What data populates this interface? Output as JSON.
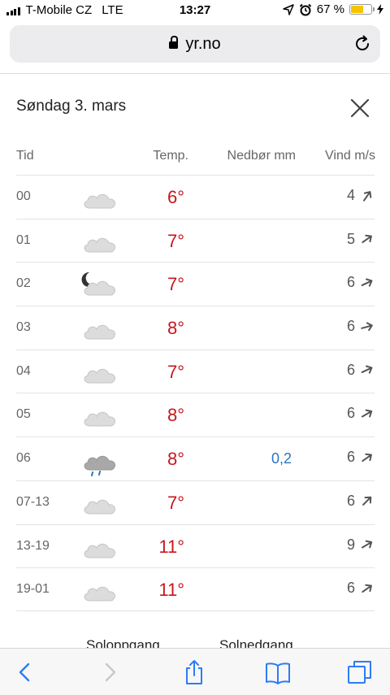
{
  "status_bar": {
    "carrier": "T-Mobile CZ",
    "network": "LTE",
    "time": "13:27",
    "battery": "67 %",
    "battery_level": 0.67,
    "battery_color": "#f5c400"
  },
  "browser": {
    "url": "yr.no"
  },
  "forecast": {
    "day_title": "Søndag 3. mars",
    "columns": {
      "time": "Tid",
      "temp": "Temp.",
      "precip": "Nedbør mm",
      "wind": "Vind m/s"
    },
    "rows": [
      {
        "time": "00",
        "icon": "cloud-icon",
        "temp": "6°",
        "precip": "",
        "wind": "4",
        "wind_dir_deg": 35
      },
      {
        "time": "01",
        "icon": "cloud-icon",
        "temp": "7°",
        "precip": "",
        "wind": "5",
        "wind_dir_deg": 55
      },
      {
        "time": "02",
        "icon": "moon-cloud-icon",
        "temp": "7°",
        "precip": "",
        "wind": "6",
        "wind_dir_deg": 65
      },
      {
        "time": "03",
        "icon": "cloud-icon",
        "temp": "8°",
        "precip": "",
        "wind": "6",
        "wind_dir_deg": 75
      },
      {
        "time": "04",
        "icon": "cloud-icon",
        "temp": "7°",
        "precip": "",
        "wind": "6",
        "wind_dir_deg": 65
      },
      {
        "time": "05",
        "icon": "cloud-icon",
        "temp": "8°",
        "precip": "",
        "wind": "6",
        "wind_dir_deg": 60
      },
      {
        "time": "06",
        "icon": "rain-cloud-icon",
        "temp": "8°",
        "precip": "0,2",
        "wind": "6",
        "wind_dir_deg": 55
      },
      {
        "time": "07-13",
        "icon": "cloud-icon",
        "temp": "7°",
        "precip": "",
        "wind": "6",
        "wind_dir_deg": 45
      },
      {
        "time": "13-19",
        "icon": "cloud-icon",
        "temp": "11°",
        "precip": "",
        "wind": "9",
        "wind_dir_deg": 60
      },
      {
        "time": "19-01",
        "icon": "cloud-icon",
        "temp": "11°",
        "precip": "",
        "wind": "6",
        "wind_dir_deg": 55
      }
    ],
    "sunrise_label": "Soloppgang",
    "sunset_label": "Solnedgang"
  },
  "colors": {
    "temp": "#c8161d",
    "precip": "#2b74c3",
    "toolbar_accent": "#2e7cf6"
  },
  "toolbar_icons": [
    "back-icon",
    "forward-icon",
    "share-icon",
    "bookmarks-icon",
    "tabs-icon"
  ]
}
